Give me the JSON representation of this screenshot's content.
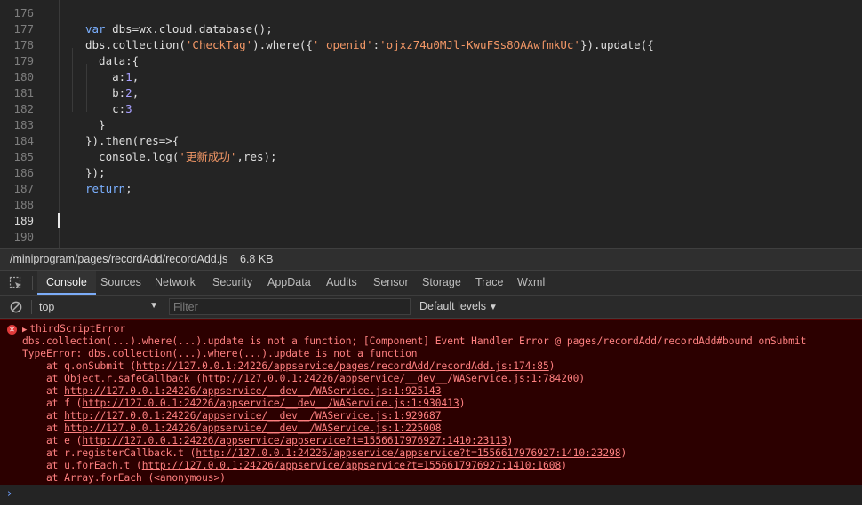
{
  "editor": {
    "lines": [
      {
        "num": "176",
        "tokens": []
      },
      {
        "num": "177",
        "tokens": [
          {
            "t": "kw",
            "v": "var"
          },
          {
            "t": "fn",
            "v": " dbs=wx.cloud.database();"
          }
        ]
      },
      {
        "num": "178",
        "tokens": [
          {
            "t": "fn",
            "v": "dbs.collection("
          },
          {
            "t": "str",
            "v": "'CheckTag'"
          },
          {
            "t": "fn",
            "v": ").where({"
          },
          {
            "t": "str",
            "v": "'_openid'"
          },
          {
            "t": "fn",
            "v": ":"
          },
          {
            "t": "str",
            "v": "'ojxz74u0MJl-KwuFSs8OAAwfmkUc'"
          },
          {
            "t": "fn",
            "v": "}).update({"
          }
        ]
      },
      {
        "num": "179",
        "tokens": [
          {
            "t": "fn",
            "v": "  data:{"
          }
        ]
      },
      {
        "num": "180",
        "tokens": [
          {
            "t": "fn",
            "v": "    a:"
          },
          {
            "t": "num",
            "v": "1"
          },
          {
            "t": "fn",
            "v": ","
          }
        ]
      },
      {
        "num": "181",
        "tokens": [
          {
            "t": "fn",
            "v": "    b:"
          },
          {
            "t": "num",
            "v": "2"
          },
          {
            "t": "fn",
            "v": ","
          }
        ]
      },
      {
        "num": "182",
        "tokens": [
          {
            "t": "fn",
            "v": "    c:"
          },
          {
            "t": "num",
            "v": "3"
          }
        ]
      },
      {
        "num": "183",
        "tokens": [
          {
            "t": "fn",
            "v": "  }"
          }
        ]
      },
      {
        "num": "184",
        "tokens": [
          {
            "t": "fn",
            "v": "}).then(res=>{"
          }
        ]
      },
      {
        "num": "185",
        "tokens": [
          {
            "t": "fn",
            "v": "  console.log("
          },
          {
            "t": "str",
            "v": "'更新成功'"
          },
          {
            "t": "fn",
            "v": ",res);"
          }
        ]
      },
      {
        "num": "186",
        "tokens": [
          {
            "t": "fn",
            "v": "});"
          }
        ]
      },
      {
        "num": "187",
        "tokens": [
          {
            "t": "kw",
            "v": "return"
          },
          {
            "t": "fn",
            "v": ";"
          }
        ]
      },
      {
        "num": "188",
        "tokens": []
      },
      {
        "num": "189",
        "tokens": [],
        "active": true
      },
      {
        "num": "190",
        "tokens": []
      }
    ]
  },
  "file_bar": {
    "path": "/miniprogram/pages/recordAdd/recordAdd.js",
    "size": "6.8 KB"
  },
  "devtools": {
    "tabs": [
      "Console",
      "Sources",
      "Network",
      "Security",
      "AppData",
      "Audits",
      "Sensor",
      "Storage",
      "Trace",
      "Wxml"
    ],
    "active_tab": "Console"
  },
  "console_toolbar": {
    "context": "top",
    "filter_placeholder": "Filter",
    "levels": "Default levels"
  },
  "error": {
    "header": "thirdScriptError",
    "message": "dbs.collection(...).where(...).update is not a function; [Component] Event Handler Error @ pages/recordAdd/recordAdd#bound onSubmit",
    "type_line": "TypeError: dbs.collection(...).where(...).update is not a function",
    "stack": [
      {
        "prefix": "    at q.onSubmit (",
        "link": "http://127.0.0.1:24226/appservice/pages/recordAdd/recordAdd.js:174:85",
        "suffix": ")"
      },
      {
        "prefix": "    at Object.r.safeCallback (",
        "link": "http://127.0.0.1:24226/appservice/__dev__/WAService.js:1:784200",
        "suffix": ")"
      },
      {
        "prefix": "    at ",
        "link": "http://127.0.0.1:24226/appservice/__dev__/WAService.js:1:925143",
        "suffix": ""
      },
      {
        "prefix": "    at f (",
        "link": "http://127.0.0.1:24226/appservice/__dev__/WAService.js:1:930413",
        "suffix": ")"
      },
      {
        "prefix": "    at ",
        "link": "http://127.0.0.1:24226/appservice/__dev__/WAService.js:1:929687",
        "suffix": ""
      },
      {
        "prefix": "    at ",
        "link": "http://127.0.0.1:24226/appservice/__dev__/WAService.js:1:225008",
        "suffix": ""
      },
      {
        "prefix": "    at e (",
        "link": "http://127.0.0.1:24226/appservice/appservice?t=1556617976927:1410:23113",
        "suffix": ")"
      },
      {
        "prefix": "    at r.registerCallback.t (",
        "link": "http://127.0.0.1:24226/appservice/appservice?t=1556617976927:1410:23298",
        "suffix": ")"
      },
      {
        "prefix": "    at u.forEach.t (",
        "link": "http://127.0.0.1:24226/appservice/appservice?t=1556617976927:1410:1608",
        "suffix": ")"
      },
      {
        "prefix": "    at Array.forEach (<anonymous>)",
        "link": "",
        "suffix": ""
      }
    ]
  },
  "prompt": {
    "chevron": "›"
  },
  "colors": {
    "keyword": "#7bb0ff",
    "string": "#f29766",
    "number": "#a8a0ff",
    "error_text": "#ff8080",
    "error_bg": "#2c0000",
    "active_tab_underline": "#7cacf8"
  }
}
